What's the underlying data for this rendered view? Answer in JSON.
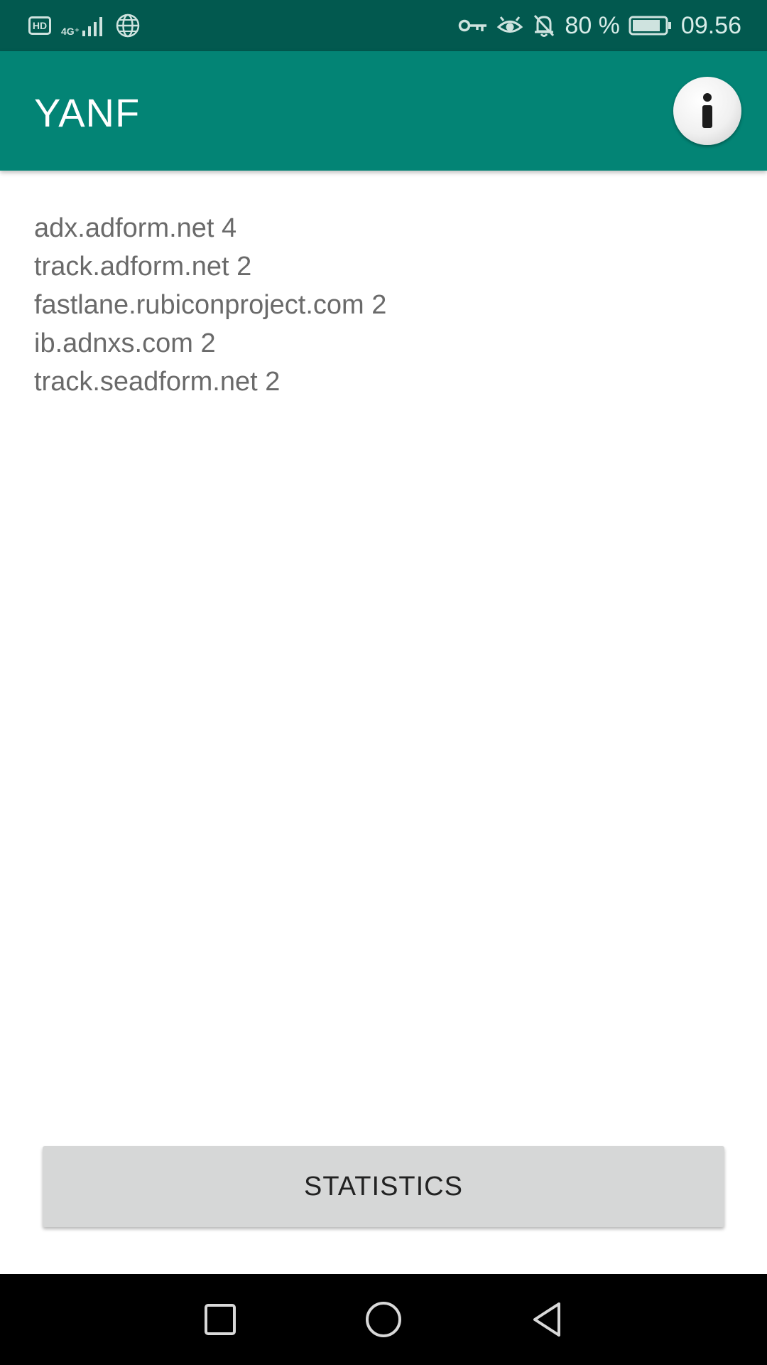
{
  "status_bar": {
    "hd_label": "HD",
    "network_label": "4G⁺",
    "battery_percent": "80 %",
    "time": "09.56",
    "icons": [
      "hd-icon",
      "signal-icon",
      "globe-icon",
      "key-icon",
      "eye-icon",
      "bell-off-icon",
      "battery-icon"
    ]
  },
  "app_bar": {
    "title": "YANF",
    "info_icon": "info-icon"
  },
  "domains": [
    {
      "text": "adx.adform.net 4"
    },
    {
      "text": "track.adform.net 2"
    },
    {
      "text": "fastlane.rubiconproject.com 2"
    },
    {
      "text": "ib.adnxs.com 2"
    },
    {
      "text": "track.seadform.net 2"
    }
  ],
  "statistics_button": {
    "label": "STATISTICS"
  },
  "nav_bar": {
    "icons": [
      "recents-icon",
      "home-icon",
      "back-icon"
    ]
  },
  "colors": {
    "status_bar": "#02594f",
    "app_bar": "#038475",
    "list_text": "#6a6a6a",
    "button_bg": "#d6d7d7"
  }
}
